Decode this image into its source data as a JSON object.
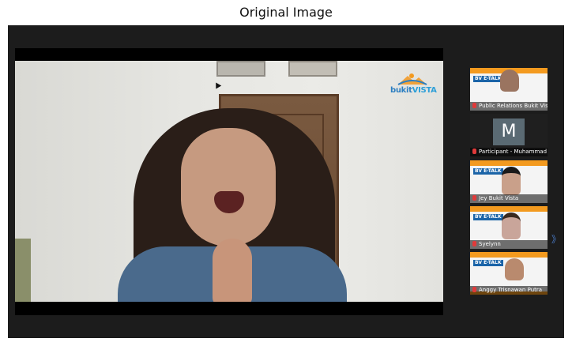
{
  "caption": "Original Image",
  "main_video": {
    "watermark_left": "bukit",
    "watermark_right": "VISTA"
  },
  "participants": [
    {
      "name": "Public Relations Bukit Vista",
      "badge": "BV E-TALK",
      "has_video": true
    },
    {
      "name": "Participant - Muhammad ...",
      "avatar_letter": "M",
      "has_video": false
    },
    {
      "name": "Jey Bukit Vista",
      "badge": "BV E-TALK",
      "has_video": true
    },
    {
      "name": "Syelynn",
      "badge": "BV E-TALK",
      "has_video": true
    },
    {
      "name": "Anggy Trisnawan Putra",
      "badge": "BV E-TALK",
      "has_video": true
    }
  ],
  "colors": {
    "app_background": "#1c1c1c",
    "brand_orange": "#f39a1f",
    "brand_blue": "#1b64a8",
    "mic_muted": "#e03a3a"
  },
  "icons": {
    "mic": "mic-off-icon",
    "side": "double-arrow-icon"
  }
}
